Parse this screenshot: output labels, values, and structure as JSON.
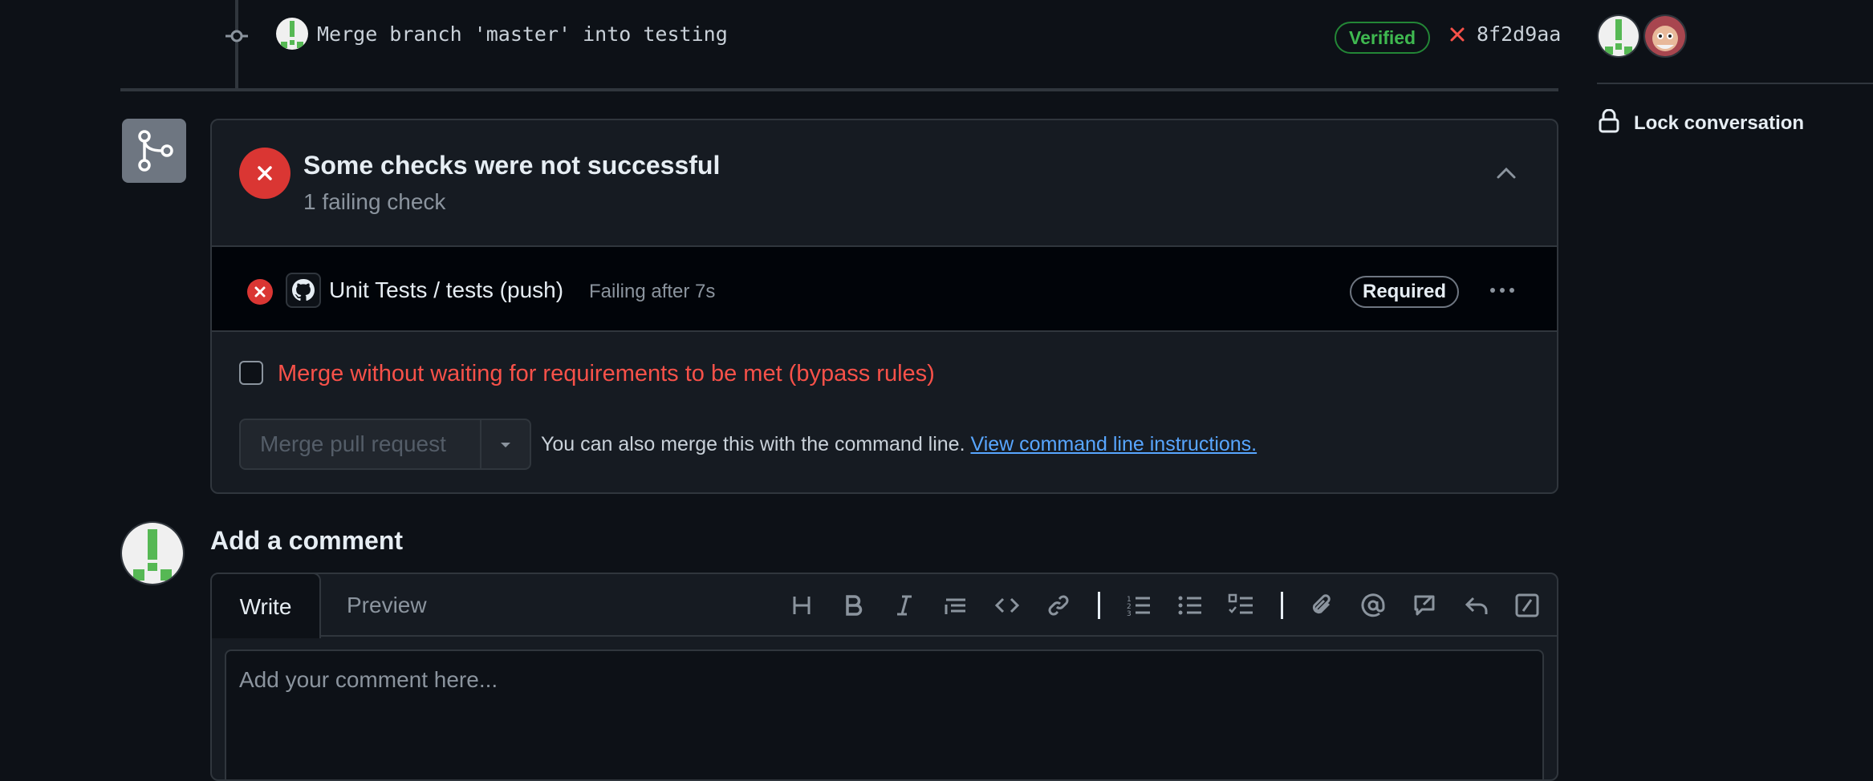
{
  "commit": {
    "message": "Merge branch 'master' into testing",
    "verified_label": "Verified",
    "sha": "8f2d9aa"
  },
  "sidebar": {
    "lock_label": "Lock conversation"
  },
  "merge": {
    "status_title": "Some checks were not successful",
    "status_sub": "1 failing check",
    "check": {
      "name": "Unit Tests / tests (push)",
      "status": "Failing after 7s",
      "badge": "Required"
    },
    "bypass_label": "Merge without waiting for requirements to be met (bypass rules)",
    "merge_button": "Merge pull request",
    "cli_text": "You can also merge this with the command line.",
    "cli_link": "View command line instructions."
  },
  "comment": {
    "title": "Add a comment",
    "tabs": [
      "Write",
      "Preview"
    ],
    "placeholder": "Add your comment here..."
  },
  "colors": {
    "background": "#0d1117",
    "danger": "#da3633",
    "success": "#3fb950",
    "link": "#58a6ff"
  }
}
